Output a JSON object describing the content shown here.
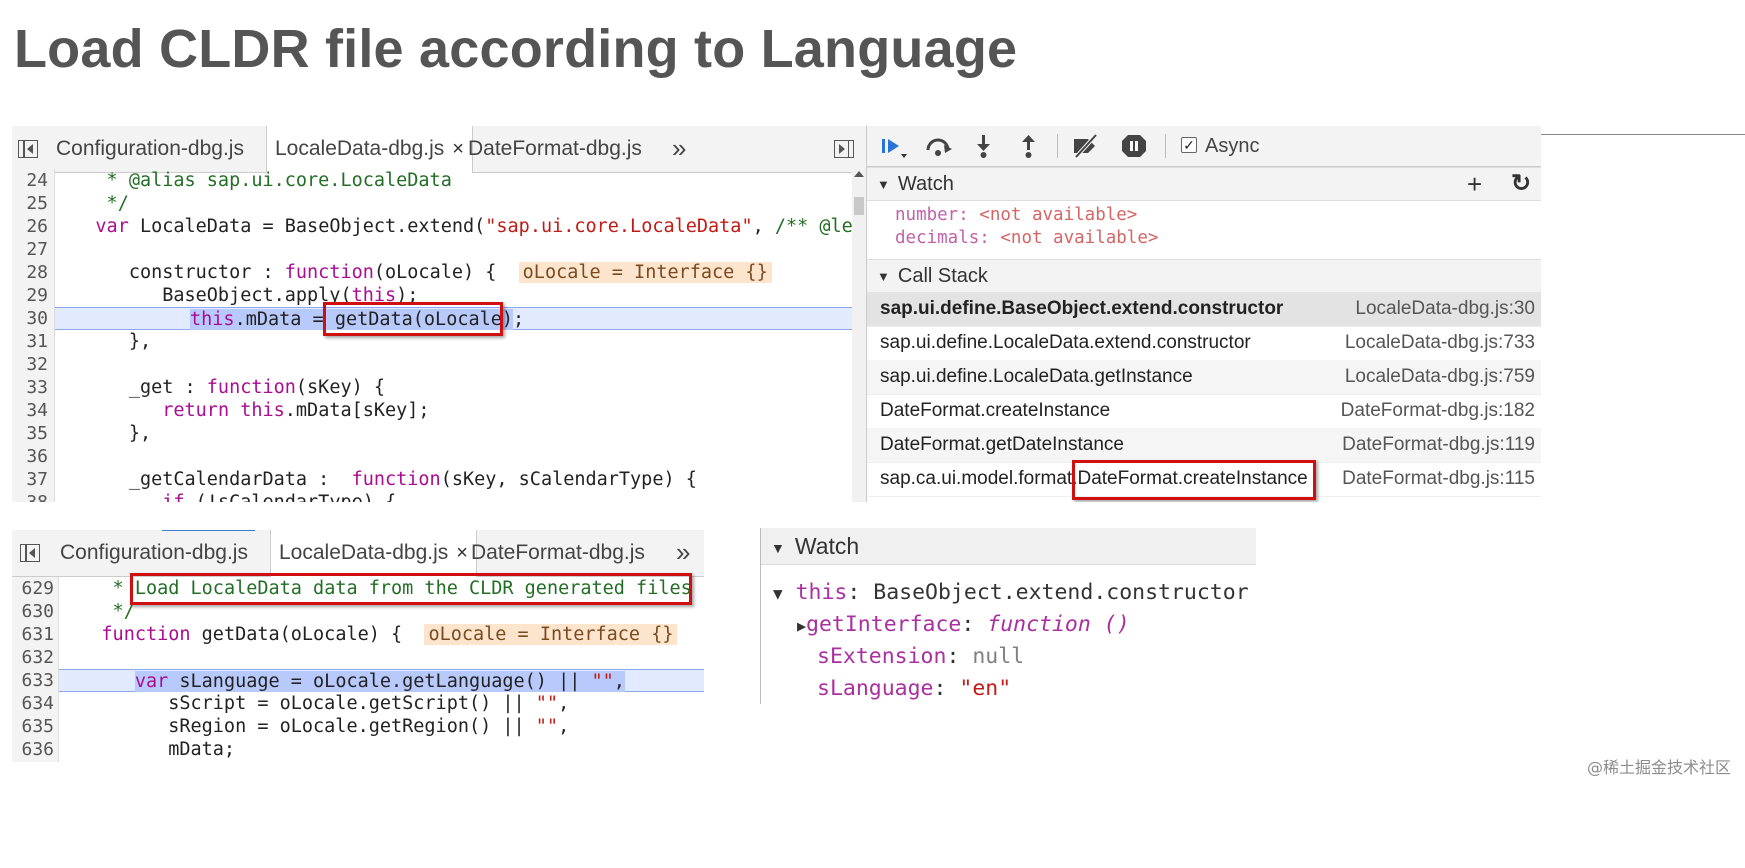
{
  "slide": {
    "title": "Load CLDR file according to Language",
    "watermark": "@稀土掘金技术社区"
  },
  "editor_top": {
    "tabs": [
      {
        "label": "Configuration-dbg.js"
      },
      {
        "label": "LocaleData-dbg.js",
        "active": true,
        "close": "×"
      },
      {
        "label": "DateFormat-dbg.js"
      }
    ],
    "overflow": "»",
    "lines": [
      {
        "n": "24",
        "text": "    * @alias sap.ui.core.LocaleData"
      },
      {
        "n": "25",
        "text": "    */"
      },
      {
        "n": "26",
        "pre": "   ",
        "kw": "var",
        "mid": " LocaleData = BaseObject.extend(",
        "str": "\"sap.ui.core.LocaleData\"",
        "post": ", ",
        "cm": "/** @lend"
      },
      {
        "n": "27",
        "text": ""
      },
      {
        "n": "28",
        "pre": "      constructor : ",
        "kw": "function",
        "mid": "(oLocale) {  ",
        "val": "oLocale = Interface {}"
      },
      {
        "n": "29",
        "pre": "         BaseObject.apply(",
        "kw": "this",
        "mid": ");"
      },
      {
        "n": "30",
        "sel": "this",
        "mid": ".mData = ",
        "boxed": "getData(oLocale)",
        "post": ";"
      },
      {
        "n": "31",
        "text": "      },"
      },
      {
        "n": "32",
        "text": ""
      },
      {
        "n": "33",
        "pre": "      _get : ",
        "kw": "function",
        "mid": "(sKey) {"
      },
      {
        "n": "34",
        "pre": "         ",
        "kw": "return",
        "mid": " ",
        "kw2": "this",
        "post": ".mData[sKey];"
      },
      {
        "n": "35",
        "text": "      },"
      },
      {
        "n": "36",
        "text": ""
      },
      {
        "n": "37",
        "pre": "      _getCalendarData :  ",
        "kw": "function",
        "mid": "(sKey, sCalendarType) {"
      },
      {
        "n": "38",
        "pre": "         ",
        "kw": "if",
        "mid": " (!sCalendarType) {"
      }
    ]
  },
  "debugger": {
    "async_label": "Async",
    "async_checked": "✓",
    "watch_title": "Watch",
    "watch_add": "+",
    "watch_refresh": "↻",
    "watch_items": [
      {
        "name": "number",
        "value": "<not available>"
      },
      {
        "name": "decimals",
        "value": "<not available>"
      }
    ],
    "callstack_title": "Call Stack",
    "frames": [
      {
        "fn": "sap.ui.define.BaseObject.extend.constructor",
        "loc": "LocaleData-dbg.js:30"
      },
      {
        "fn": "sap.ui.define.LocaleData.extend.constructor",
        "loc": "LocaleData-dbg.js:733"
      },
      {
        "fn": "sap.ui.define.LocaleData.getInstance",
        "loc": "LocaleData-dbg.js:759"
      },
      {
        "fn": "DateFormat.createInstance",
        "loc": "DateFormat-dbg.js:182"
      },
      {
        "fn": "DateFormat.getDateInstance",
        "loc": "DateFormat-dbg.js:119"
      },
      {
        "fn_prefix": "sap.ca.ui.model.format.",
        "fn_boxed": "DateFormat.createInstance",
        "loc": "DateFormat-dbg.js:115"
      }
    ]
  },
  "editor_bottom": {
    "tabs": [
      {
        "label": "Configuration-dbg.js"
      },
      {
        "label": "LocaleData-dbg.js",
        "active": true,
        "close": "×"
      },
      {
        "label": "DateFormat-dbg.js"
      }
    ],
    "overflow": "»",
    "lines": [
      {
        "n": "629",
        "pre": "    *",
        "boxed": "Load LocaleData data from the CLDR generated files"
      },
      {
        "n": "630",
        "text": "    */"
      },
      {
        "n": "631",
        "pre": "   ",
        "kw": "function",
        "mid": " getData(oLocale) {  ",
        "val": "oLocale = Interface {}"
      },
      {
        "n": "632",
        "text": ""
      },
      {
        "n": "633",
        "pre": "      ",
        "selkw": "var",
        "selmid": " sLanguage = oLocale.getLanguage() || ",
        "selstr": "\"\"",
        "selpost": ","
      },
      {
        "n": "634",
        "pre": "         sScript = oLocale.getScript() || ",
        "str": "\"\"",
        "post": ","
      },
      {
        "n": "635",
        "pre": "         sRegion = oLocale.getRegion() || ",
        "str": "\"\"",
        "post": ","
      },
      {
        "n": "636",
        "text": "         mData;"
      }
    ]
  },
  "watch_bottom": {
    "title": "Watch",
    "root_name": "this",
    "root_value": "BaseObject.extend.constructor",
    "children": [
      {
        "name": "getInterface",
        "value": "function ()",
        "type": "function"
      },
      {
        "name": "sExtension",
        "value": "null",
        "type": "null"
      },
      {
        "name": "sLanguage",
        "value": "\"en\"",
        "type": "string"
      }
    ]
  }
}
